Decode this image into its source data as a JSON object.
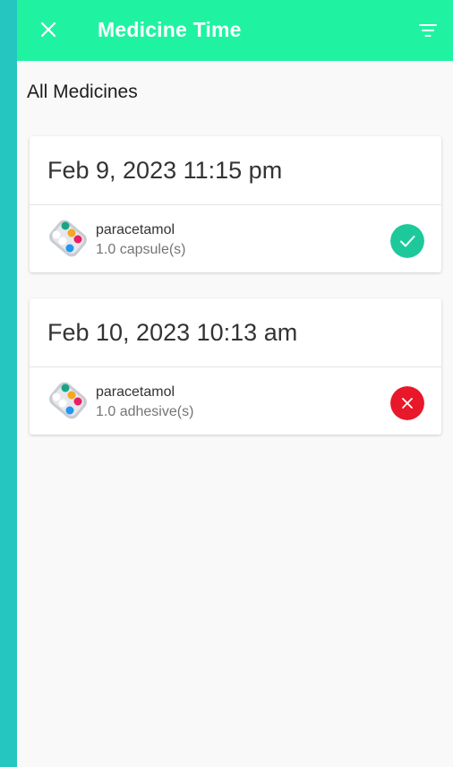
{
  "appbar": {
    "title": "Medicine Time",
    "close_icon": "close-icon",
    "filter_icon": "filter-icon",
    "background": "#1ff3a1"
  },
  "section_title": "All Medicines",
  "entries": [
    {
      "date": "Feb 9, 2023 11:15 pm",
      "medicine": "paracetamol",
      "dose": "1.0 capsule(s)",
      "status": "taken",
      "status_icon": "check-icon",
      "status_color": "#1dc99a"
    },
    {
      "date": "Feb 10, 2023 10:13 am",
      "medicine": "paracetamol",
      "dose": "1.0 adhesive(s)",
      "status": "missed",
      "status_icon": "close-icon",
      "status_color": "#e8172a"
    }
  ]
}
